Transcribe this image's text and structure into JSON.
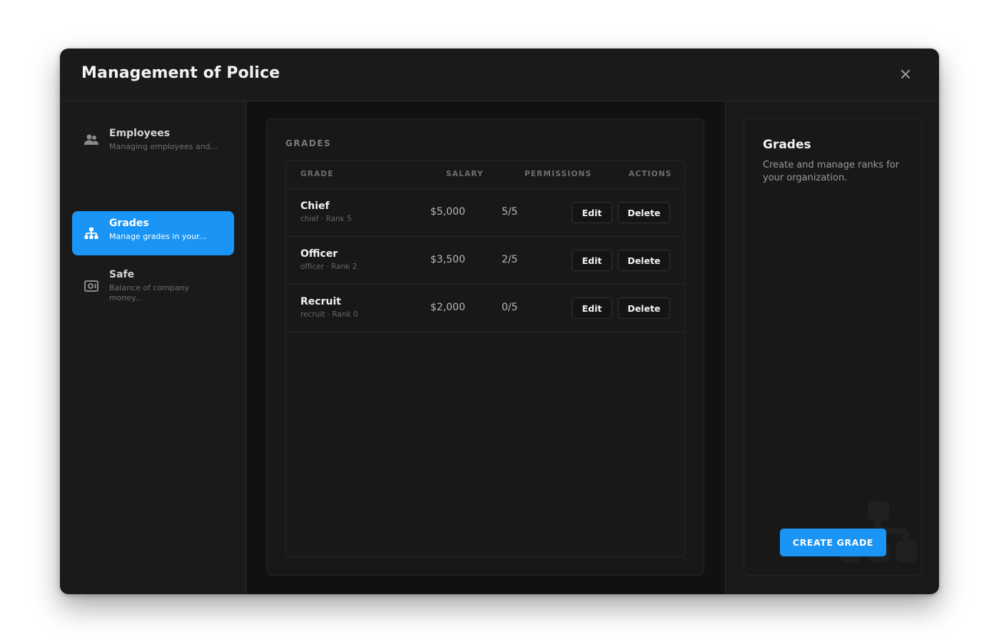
{
  "modal": {
    "title": "Management of Police"
  },
  "icons": {
    "close": "close-icon"
  },
  "colors": {
    "accent": "#1a95f5",
    "background": "#1a1a1a",
    "panel": "#181818"
  },
  "sidebar": {
    "items": [
      {
        "label": "Employees",
        "description": "Managing employees and...",
        "icon": "users-icon",
        "active": false
      },
      {
        "label": "Grades",
        "description": "Manage grades in your...",
        "icon": "hierarchy-icon",
        "active": true
      },
      {
        "label": "Safe",
        "description": "Balance of company money...",
        "icon": "safe-icon",
        "active": false
      }
    ]
  },
  "grades": {
    "section_title": "GRADES",
    "columns": {
      "grade": "GRADE",
      "salary": "SALARY",
      "permissions": "PERMISSIONS",
      "actions": "ACTIONS"
    },
    "edit_label": "Edit",
    "delete_label": "Delete",
    "rows": [
      {
        "name": "Chief",
        "meta": "chief · Rank 5",
        "salary": "$5,000",
        "permissions": "5/5"
      },
      {
        "name": "Officer",
        "meta": "officer · Rank 2",
        "salary": "$3,500",
        "permissions": "2/5"
      },
      {
        "name": "Recruit",
        "meta": "recruit · Rank 0",
        "salary": "$2,000",
        "permissions": "0/5"
      }
    ]
  },
  "info": {
    "title": "Grades",
    "description": "Create and manage ranks for your organization.",
    "button": "CREATE GRADE",
    "watermark_icon": "hierarchy-icon"
  }
}
